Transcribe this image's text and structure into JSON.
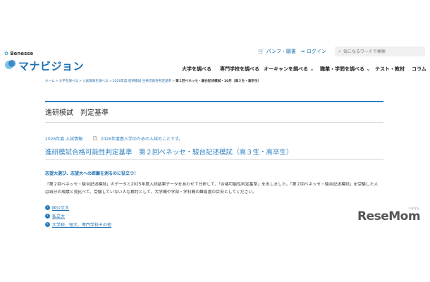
{
  "header": {
    "brand": "Benesse",
    "site_name": "マナビジョン",
    "pamphlet_label": "パンフ・願書",
    "login_label": "ログイン",
    "search_placeholder": "気になるワードで検索"
  },
  "gnav": {
    "items": [
      "大学を調べる",
      "専門学校を調べる",
      "オーキャンを調べる",
      "職業・学問を調べる",
      "テスト・教材",
      "コラム"
    ]
  },
  "breadcrumb": {
    "items": [
      "ホーム",
      "大学を調べる",
      "入試情報を調べる",
      "2026年度 進研模試 合格可能性判定基準"
    ],
    "current": "第２回ベネッセ・駿台記述模試・10月（高３生・高卒生）"
  },
  "page": {
    "title": "進研模試　判定基準",
    "meta_year": "2026年度 入試情報",
    "meta_note": "2026年度春入学のための入試のことです。",
    "heading": "進研模試合格可能性判定基準　第２回ベネッセ・駿台記述模試（高３生・高卒生）",
    "lead": "志望大選び、志望大への距離を測るのに役立つ！",
    "body": "「第２回ベネッセ・駿台記述模試」のデータと2025年度入試結果データをあわせて分析して、「合格可能性判定基準」を出しました。「第２回ベネッセ・駿台記述模試」を受験した人は自分の成績と見比べて、受験していない人も検討として、大学間や学部・学科間の難易度の目安としてください。",
    "links": [
      "国公立大",
      "私立大",
      "大学校、短大、専門学校その他"
    ]
  },
  "watermark": {
    "text": "ReseMom",
    "small": "リセマム"
  },
  "colors": {
    "accent": "#2b7fc0",
    "link": "#1e6fb0"
  }
}
